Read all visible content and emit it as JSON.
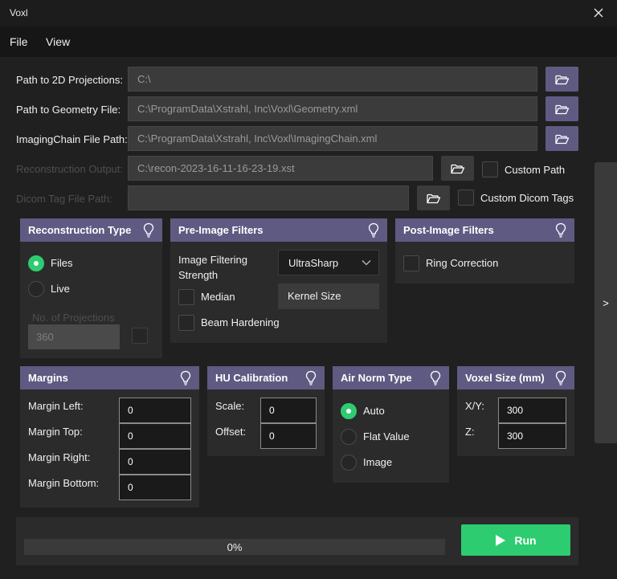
{
  "window": {
    "title": "Voxl"
  },
  "menu": {
    "file": "File",
    "view": "View"
  },
  "paths": {
    "projections": {
      "label": "Path to 2D Projections:",
      "value": "C:\\"
    },
    "geometry": {
      "label": "Path to Geometry File:",
      "value": "C:\\ProgramData\\Xstrahl, Inc\\Voxl\\Geometry.xml"
    },
    "imaging_chain": {
      "label": "ImagingChain File Path:",
      "value": "C:\\ProgramData\\Xstrahl, Inc\\Voxl\\ImagingChain.xml"
    },
    "recon_output": {
      "label": "Reconstruction Output:",
      "value": "C:\\recon-2023-16-11-16-23-19.xst",
      "checkbox_label": "Custom Path"
    },
    "dicom": {
      "label": "Dicom Tag File Path:",
      "value": "",
      "checkbox_label": "Custom Dicom Tags"
    }
  },
  "recon_type": {
    "title": "Reconstruction Type",
    "files": "Files",
    "live": "Live",
    "projections_label": "No. of Projections",
    "projections_value": "360"
  },
  "pre_filters": {
    "title": "Pre-Image Filters",
    "strength_label": "Image Filtering Strength",
    "strength_value": "UltraSharp",
    "median": "Median",
    "kernel": "Kernel Size",
    "beam": "Beam Hardening"
  },
  "post_filters": {
    "title": "Post-Image Filters",
    "ring": "Ring Correction"
  },
  "margins": {
    "title": "Margins",
    "left": {
      "label": "Margin Left:",
      "value": "0"
    },
    "top": {
      "label": "Margin Top:",
      "value": "0"
    },
    "right": {
      "label": "Margin Right:",
      "value": "0"
    },
    "bottom": {
      "label": "Margin Bottom:",
      "value": "0"
    }
  },
  "hu": {
    "title": "HU Calibration",
    "scale": {
      "label": "Scale:",
      "value": "0"
    },
    "offset": {
      "label": "Offset:",
      "value": "0"
    }
  },
  "air_norm": {
    "title": "Air Norm Type",
    "auto": "Auto",
    "flat": "Flat Value",
    "image": "Image"
  },
  "voxel": {
    "title": "Voxel Size (mm)",
    "xy": {
      "label": "X/Y:",
      "value": "300"
    },
    "z": {
      "label": "Z:",
      "value": "300"
    }
  },
  "progress": {
    "text": "0%",
    "fraction": 0
  },
  "run": {
    "label": "Run"
  },
  "side_toggle": {
    "label": ">"
  },
  "colors": {
    "accent": "#5f5a82",
    "success": "#2ecc71",
    "background": "#202020"
  },
  "icons": [
    "close-icon",
    "folder-open-icon",
    "lightbulb-icon",
    "play-icon"
  ]
}
